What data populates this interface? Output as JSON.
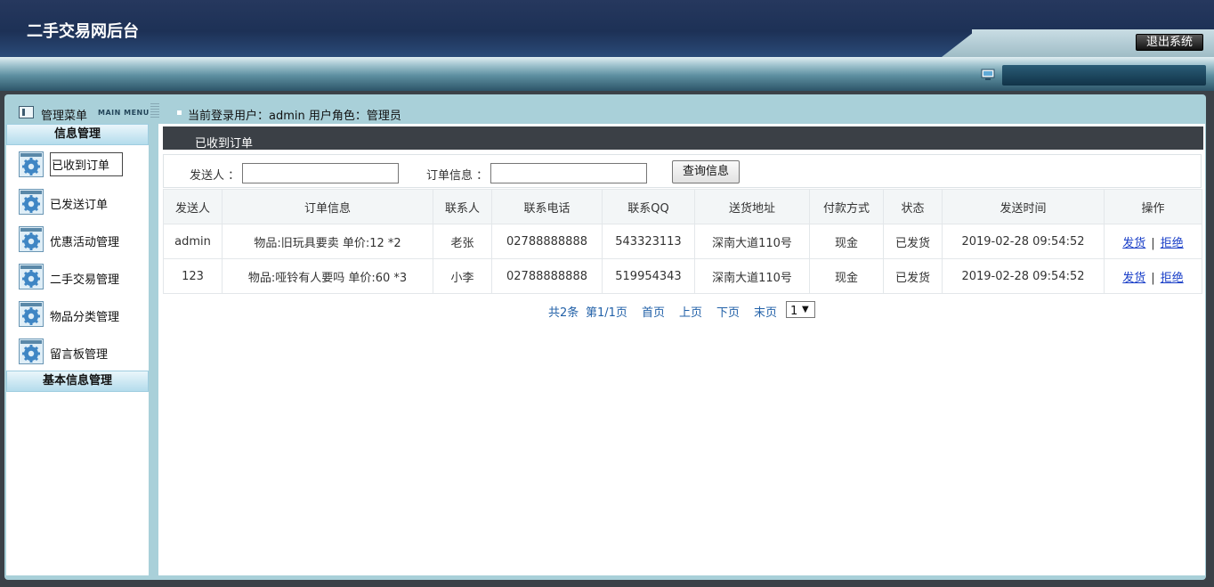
{
  "header": {
    "title": "二手交易网后台",
    "logout": "退出系统"
  },
  "infobar": {
    "menu_title": "管理菜单",
    "menu_en": "MAIN MENU",
    "user_info": "当前登录用户：admin  用户角色：管理员"
  },
  "sidebar": {
    "group1": "信息管理",
    "items": [
      {
        "label": "已收到订单"
      },
      {
        "label": "已发送订单"
      },
      {
        "label": "优惠活动管理"
      },
      {
        "label": "二手交易管理"
      },
      {
        "label": "物品分类管理"
      },
      {
        "label": "留言板管理"
      }
    ],
    "group2": "基本信息管理"
  },
  "content": {
    "title": "已收到订单",
    "search": {
      "sender_label": "发送人 ：",
      "sender_value": "",
      "order_label": "订单信息 ：",
      "order_value": "",
      "button": "查询信息"
    },
    "table": {
      "headers": [
        "发送人",
        "订单信息",
        "联系人",
        "联系电话",
        "联系QQ",
        "送货地址",
        "付款方式",
        "状态",
        "发送时间",
        "操作"
      ],
      "rows": [
        [
          "admin",
          "物品:旧玩具要卖 单价:12 *2",
          "老张",
          "02788888888",
          "543323113",
          "深南大道110号",
          "现金",
          "已发货",
          "2019-02-28 09:54:52"
        ],
        [
          "123",
          "物品:哑铃有人要吗 单价:60 *3",
          "小李",
          "02788888888",
          "519954343",
          "深南大道110号",
          "现金",
          "已发货",
          "2019-02-28 09:54:52"
        ]
      ],
      "actions": {
        "ship": "发货",
        "sep": "|",
        "reject": "拒绝"
      }
    },
    "pager": {
      "total": "共2条",
      "page": "第1/1页",
      "first": "首页",
      "prev": "上页",
      "next": "下页",
      "last": "末页",
      "selected": "1"
    }
  },
  "colors": {
    "header_bg": "#1d3156",
    "frame_bg": "#a9d0d9",
    "title_bar": "#3b4046",
    "link": "#1a3fc8",
    "pager": "#2261a8"
  }
}
